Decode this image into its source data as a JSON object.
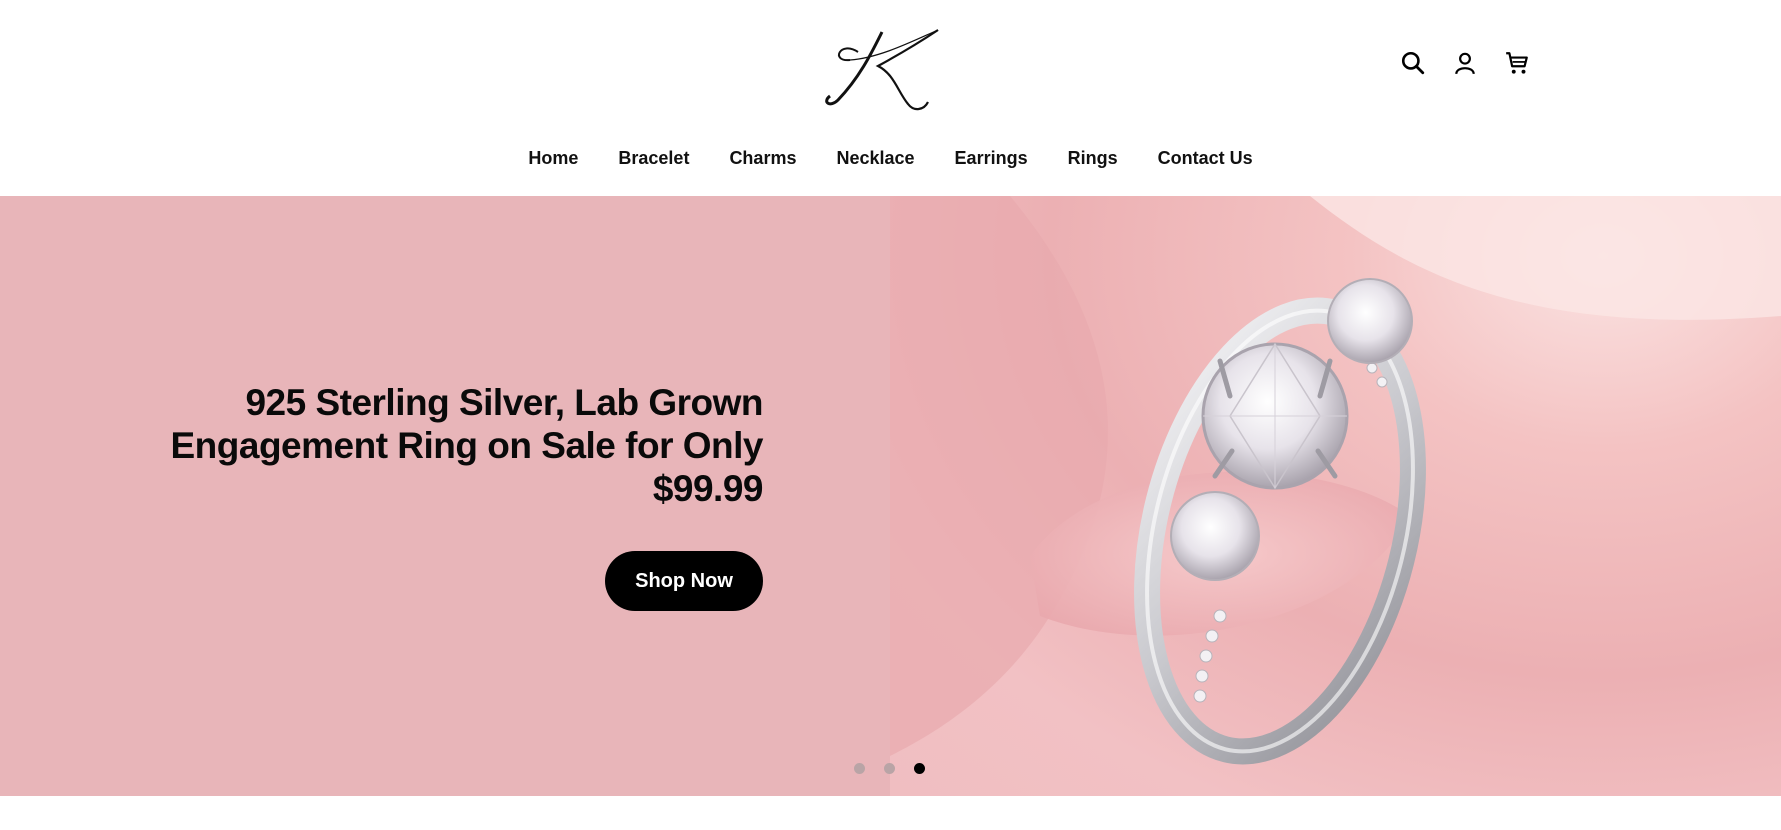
{
  "brand": {
    "logo_letter": "K"
  },
  "header_icons": [
    "search-icon",
    "account-icon",
    "cart-icon"
  ],
  "nav": {
    "items": [
      {
        "label": "Home"
      },
      {
        "label": "Bracelet"
      },
      {
        "label": "Charms"
      },
      {
        "label": "Necklace"
      },
      {
        "label": "Earrings"
      },
      {
        "label": "Rings"
      },
      {
        "label": "Contact Us"
      }
    ]
  },
  "hero": {
    "headline_line1": "925 Sterling Silver, Lab Grown",
    "headline_line2": "Engagement Ring on Sale for Only",
    "headline_line3": "$99.99",
    "button_label": "Shop Now",
    "slide_count": 3,
    "active_slide": 3,
    "background_color": "#e8b5b9"
  },
  "colors": {
    "accent": "#000000",
    "hero_bg": "#e8b5b9"
  }
}
